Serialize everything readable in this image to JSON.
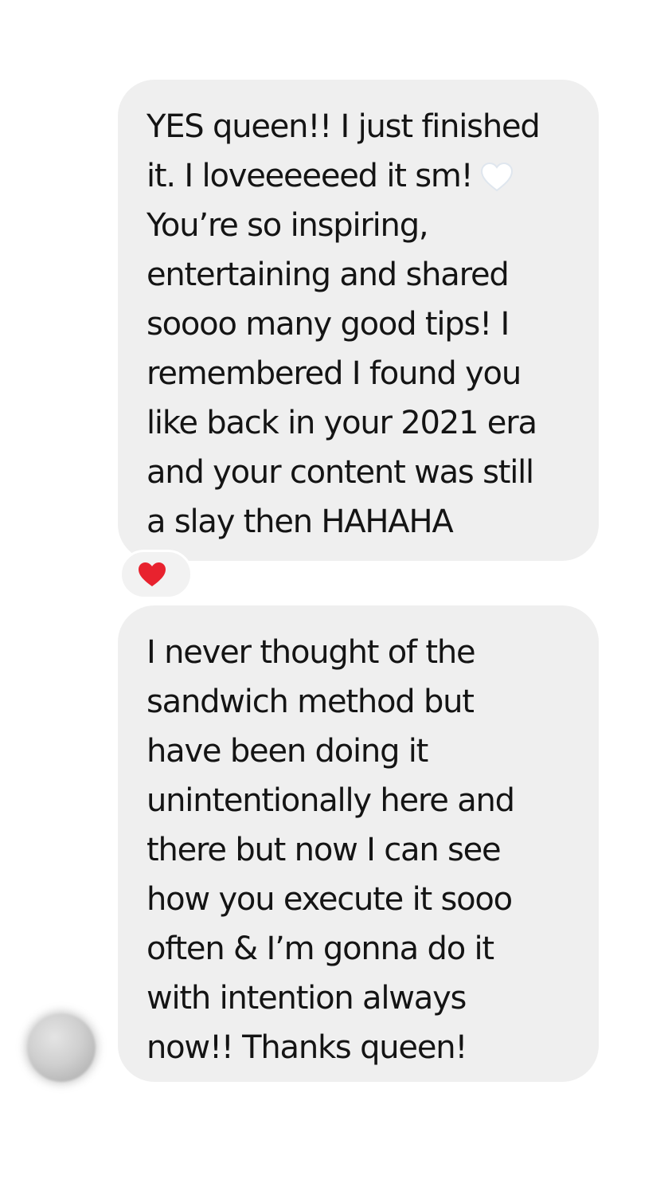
{
  "messages": [
    {
      "lines": [
        "YES queen!! I just finished",
        "it. I loveeeeeed it sm!",
        "You’re so inspiring,",
        "entertaining and shared",
        "soooo many good tips! I",
        "remembered I found you",
        "like back in your 2021 era",
        "and your content was still",
        "a slay then HAHAHA"
      ],
      "inline_emoji": "white-heart-icon",
      "reaction": {
        "icon": "red-heart-icon",
        "color": "#e8222e"
      }
    },
    {
      "lines": [
        "I never thought of the",
        "sandwich method but",
        "have been doing it",
        "unintentionally here and",
        "there but now I can see",
        "how you execute it sooo",
        "often & I’m gonna do it",
        "with intention always",
        "now!! Thanks queen!"
      ]
    }
  ],
  "colors": {
    "bubble_background": "#efefef",
    "text": "#141414",
    "reaction_heart": "#e8222e"
  }
}
